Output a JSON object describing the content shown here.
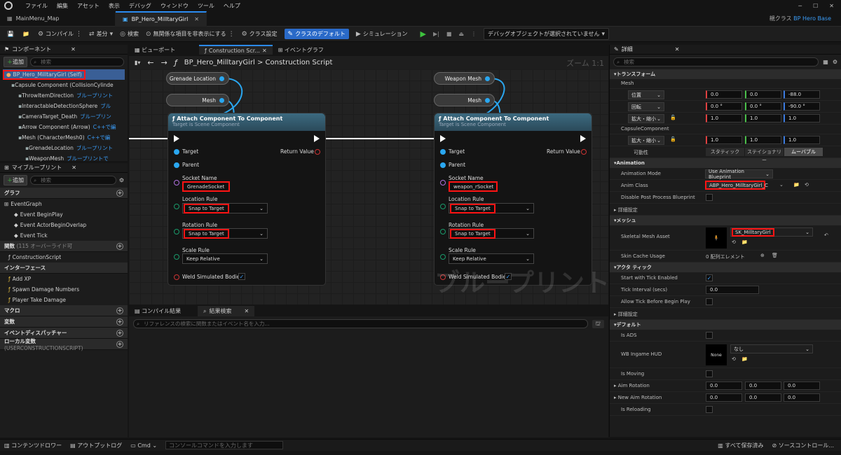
{
  "menu": [
    "ファイル",
    "編集",
    "アセット",
    "表示",
    "デバッグ",
    "ウィンドウ",
    "ツール",
    "ヘルプ"
  ],
  "tabs": [
    {
      "label": "MainMenu_Map"
    },
    {
      "label": "BP_Hero_MilltaryGirl"
    }
  ],
  "parent_class": {
    "prefix": "親クラス",
    "value": "BP Hero Base"
  },
  "toolbar": {
    "compile": "コンパイル",
    "diff": "差分",
    "find": "検索",
    "hide": "無関係な項目を非表示にする",
    "class_settings": "クラス設定",
    "class_defaults": "クラスのデフォルト",
    "simulation": "シミュレーション",
    "debug_object": "デバッグオブジェクトが選択されていません"
  },
  "components": {
    "title": "コンポーネント",
    "add": "追加",
    "search_placeholder": "検索",
    "self": "BP_Hero_MilltaryGirl (Self)",
    "items": [
      {
        "name": "Capsule Component (CollisionCylinde",
        "link": ""
      },
      {
        "name": "ThrowItemDirection",
        "link": "ブループリント"
      },
      {
        "name": "InteractableDetectionSphere",
        "link": "ブル"
      },
      {
        "name": "CameraTarget_Death",
        "link": "ブループリン"
      },
      {
        "name": "Arrow Component (Arrow)",
        "link": "C++で編"
      },
      {
        "name": "Mesh (CharacterMesh0)",
        "link": "C++で編"
      },
      {
        "name": "GrenadeLocation",
        "link": "ブループリント"
      },
      {
        "name": "WeaponMesh",
        "link": "ブループリントで"
      }
    ]
  },
  "myblueprint": {
    "title": "マイブループリント",
    "add": "追加",
    "search_placeholder": "検索",
    "graph_section": "グラフ",
    "event_graph": "EventGraph",
    "events": [
      "Event BeginPlay",
      "Event ActorBeginOverlap",
      "Event Tick"
    ],
    "functions_section": "関数",
    "functions_override": "(115 オーバーライド可",
    "construction_script": "ConstructionScript",
    "interfaces_section": "インターフェース",
    "interfaces": [
      "Add XP",
      "Spawn Damage Numbers",
      "Player Take Damage"
    ],
    "macros": "マクロ",
    "variables": "変数",
    "dispatchers": "イベントディスパッチャー",
    "local_vars": "ローカル変数",
    "local_vars_sub": "(USERCONSTRUCTIONSCRIPT)"
  },
  "graph_tabs": {
    "viewport": "ビューポート",
    "construction": "Construction Scr...",
    "event_graph": "イベントグラフ"
  },
  "breadcrumb": {
    "blueprint": "BP_Hero_MilltaryGirl",
    "separator": ">",
    "graph": "Construction Script"
  },
  "zoom": "ズーム 1:1",
  "watermark": "ブループリント",
  "nodes": {
    "grenade_location": "Grenade Location",
    "mesh": "Mesh",
    "weapon_mesh": "Weapon Mesh",
    "attach_title": "Attach Component To Component",
    "attach_sub": "Target is Scene Component",
    "target": "Target",
    "parent": "Parent",
    "return_value": "Return Value",
    "socket_name": "Socket Name",
    "location_rule": "Location Rule",
    "rotation_rule": "Rotation Rule",
    "scale_rule": "Scale Rule",
    "weld": "Weld Simulated Bodies",
    "socket1": "GrenadeSocket",
    "socket2": "weapon_rSocket",
    "snap": "Snap to Target",
    "keep": "Keep Relative"
  },
  "bottom": {
    "compile_results": "コンパイル結果",
    "find_results": "結果検索",
    "search_placeholder": "リファレンスの検索に関数またはイベント名を入力..."
  },
  "details": {
    "title": "詳細",
    "search_placeholder": "検索",
    "transform": "トランスフォーム",
    "mesh_sub": "Mesh",
    "location": "位置",
    "rotation": "回転",
    "scale": "拡大・縮小",
    "loc_vals": [
      "0.0",
      "0.0",
      "-88.0"
    ],
    "rot_vals": [
      "0.0 °",
      "0.0 °",
      "-90.0 °"
    ],
    "scale_vals": [
      "1.0",
      "1.0",
      "1.0"
    ],
    "capsule_sub": "CapsuleComponent",
    "cap_scale": [
      "1.0",
      "1.0",
      "1.0"
    ],
    "mobility": "可動性",
    "mob_opts": [
      "スタティック",
      "ステイショナリー",
      "ムーバブル"
    ],
    "animation": "Animation",
    "anim_mode_l": "Animation Mode",
    "anim_mode_v": "Use Animation Blueprint",
    "anim_class_l": "Anim Class",
    "anim_class_v": "ABP_Hero_MilltaryGirl_C",
    "disable_pp": "Disable Post Process Blueprint",
    "adv_settings": "詳細設定",
    "mesh_section": "メッシュ",
    "skel_l": "Skeletal Mesh Asset",
    "skel_v": "SK_MilltaryGirl",
    "skin_cache_l": "Skin Cache Usage",
    "skin_cache_v": "0 配列エレメント",
    "actor_tick": "アクタ ティック",
    "start_tick": "Start with Tick Enabled",
    "tick_interval": "Tick Interval (secs)",
    "tick_interval_v": "0.0",
    "allow_tick": "Allow Tick Before Begin Play",
    "defaults": "デフォルト",
    "is_ads": "Is ADS",
    "wb_hud": "WB Ingame HUD",
    "wb_hud_thumb": "None",
    "wb_hud_v": "なし",
    "is_moving": "Is Moving",
    "aim_rot": "Aim Rotation",
    "aim_vals": [
      "0.0",
      "0.0",
      "0.0"
    ],
    "new_aim": "New Aim Rotation",
    "new_aim_vals": [
      "0.0",
      "0.0",
      "0.0"
    ],
    "is_reloading": "Is Reloading"
  },
  "status": {
    "content_drawer": "コンテンツドロワー",
    "output_log": "アウトプットログ",
    "cmd": "Cmd",
    "cmd_placeholder": "コンソールコマンドを入力します",
    "save_all": "すべて保存済み",
    "source_control": "ソースコントロール..."
  }
}
